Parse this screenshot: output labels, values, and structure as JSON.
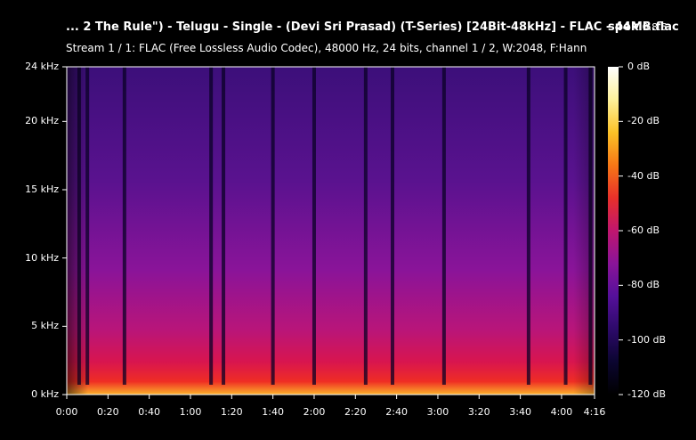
{
  "header": {
    "title": "... 2 The Rule\") - Telugu - Single - (Devi Sri Prasad) (T-Series) [24Bit-48kHz] - FLAC - 44MB.flac",
    "app_name": "spek",
    "app_version": "0.8.5",
    "stream_info": "Stream 1 / 1: FLAC (Free Lossless Audio Codec), 48000 Hz, 24 bits, channel 1 / 2, W:2048, F:Hann"
  },
  "frequency_axis": {
    "labels": [
      "24 kHz",
      "20 kHz",
      "15 kHz",
      "10 kHz",
      "5 kHz",
      "0 kHz"
    ],
    "values_khz": [
      24,
      20,
      15,
      10,
      5,
      0
    ],
    "range_khz": [
      0,
      24
    ]
  },
  "time_axis": {
    "labels": [
      "0:00",
      "0:20",
      "0:40",
      "1:00",
      "1:20",
      "1:40",
      "2:00",
      "2:20",
      "2:40",
      "3:00",
      "3:20",
      "3:40",
      "4:00",
      "4:16"
    ],
    "values_sec": [
      0,
      20,
      40,
      60,
      80,
      100,
      120,
      140,
      160,
      180,
      200,
      220,
      240,
      256
    ],
    "range_sec": [
      0,
      256
    ]
  },
  "colorbar": {
    "labels": [
      "0 dB",
      "-20 dB",
      "-40 dB",
      "-60 dB",
      "-80 dB",
      "-100 dB",
      "-120 dB"
    ],
    "values_db": [
      0,
      -20,
      -40,
      -60,
      -80,
      -100,
      -120
    ],
    "range_db": [
      -120,
      0
    ],
    "gradient": [
      "#000000",
      "#0b0530",
      "#2d0a6a",
      "#55109a",
      "#8a1499",
      "#c0166e",
      "#e8302a",
      "#f77716",
      "#fbc227",
      "#fdf19b",
      "#ffffff"
    ]
  },
  "spectrogram": {
    "quiet_moments_sec": [
      6,
      10,
      28,
      70,
      76,
      100,
      120,
      145,
      158,
      183,
      224,
      242,
      254
    ]
  }
}
